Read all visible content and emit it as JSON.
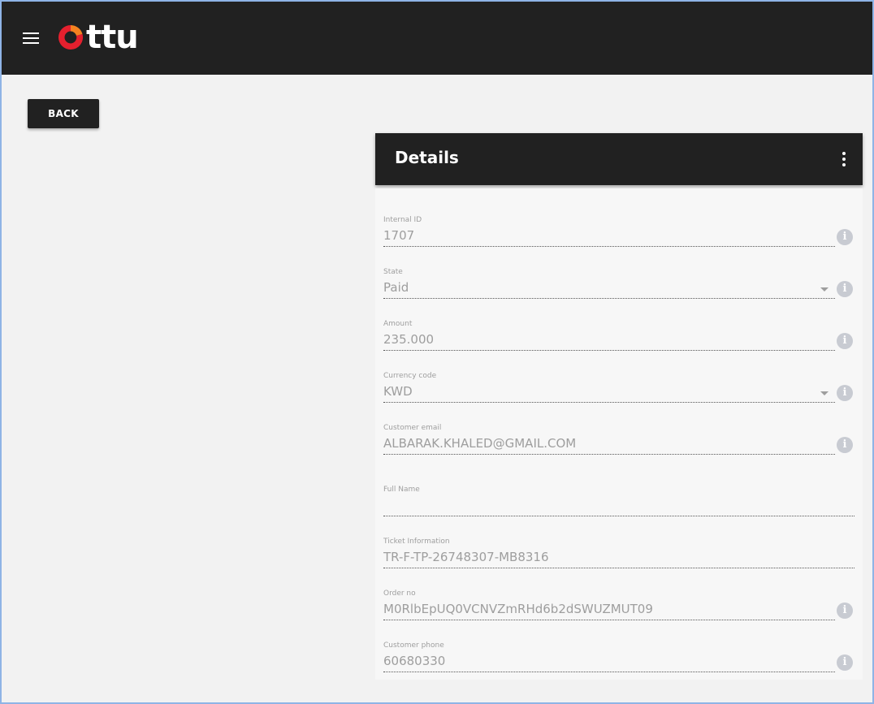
{
  "app": {
    "logo_text": "ttu",
    "brand_colors": {
      "logo_orange": "#f58220",
      "logo_red": "#e5202e",
      "header_bg": "#212121"
    }
  },
  "toolbar": {
    "back_label": "BACK"
  },
  "details": {
    "title": "Details",
    "fields": {
      "internal_id": {
        "label": "Internal ID",
        "value": "1707"
      },
      "state": {
        "label": "State",
        "value": "Paid"
      },
      "amount": {
        "label": "Amount",
        "value": "235.000"
      },
      "currency_code": {
        "label": "Currency code",
        "value": "KWD"
      },
      "customer_email": {
        "label": "Customer email",
        "value": "ALBARAK.KHALED@GMAIL.COM"
      },
      "full_name": {
        "label": "Full Name",
        "value": ""
      },
      "ticket_information": {
        "label": "Ticket Information",
        "value": "TR-F-TP-26748307-MB8316"
      },
      "order_no": {
        "label": "Order no",
        "value": "M0RlbEpUQ0VCNVZmRHd6b2dSWUZMUT09"
      },
      "customer_phone": {
        "label": "Customer phone",
        "value": "60680330"
      }
    },
    "info_glyph": "i"
  }
}
